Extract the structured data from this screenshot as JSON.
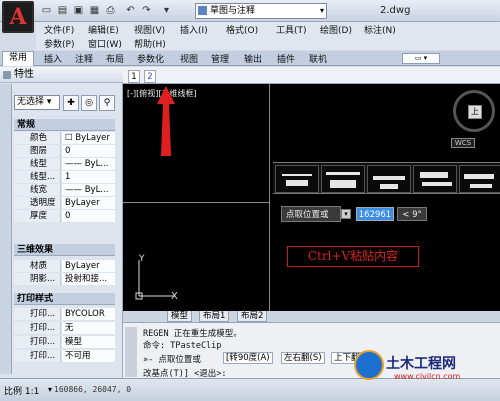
{
  "app": {
    "logo_letter": "A",
    "workspace": "草图与注释",
    "document_title": "2.dwg"
  },
  "menu_row1": [
    "文件(F)",
    "编辑(E)",
    "视图(V)",
    "插入(I)",
    "格式(O)",
    "工具(T)",
    "绘图(D)",
    "标注(N)"
  ],
  "menu_row2": [
    "参数(P)",
    "窗口(W)",
    "帮助(H)"
  ],
  "ribbon_tabs": [
    "常用",
    "插入",
    "注释",
    "布局",
    "参数化",
    "视图",
    "管理",
    "输出",
    "插件",
    "联机"
  ],
  "properties": {
    "title": "特性",
    "selection": "无选择",
    "sections": [
      {
        "name": "常规",
        "rows": [
          [
            "颜色",
            "☐ ByLayer"
          ],
          [
            "图层",
            "0"
          ],
          [
            "线型",
            "—— ByL..."
          ],
          [
            "线型...",
            "1"
          ],
          [
            "线宽",
            "—— ByL..."
          ],
          [
            "透明度",
            "ByLayer"
          ],
          [
            "厚度",
            "0"
          ]
        ]
      },
      {
        "name": "三维效果",
        "rows": [
          [
            "材质",
            "ByLayer"
          ],
          [
            "阴影...",
            "投射和接..."
          ]
        ]
      },
      {
        "name": "打印样式",
        "rows": [
          [
            "打印...",
            "BYCOLOR"
          ],
          [
            "打印...",
            "无"
          ],
          [
            "打印...",
            "模型"
          ],
          [
            "打印...",
            "不可用"
          ]
        ]
      }
    ]
  },
  "doc_tabs": [
    "1",
    "2"
  ],
  "viewport_label": "[-][俯视][二维线框]",
  "viewcube": {
    "face": "上",
    "wcs": "WCS"
  },
  "snap": {
    "label": "点取位置或",
    "value": "162961",
    "angle": "< 9°"
  },
  "annotation": "Ctrl+V粘贴内容",
  "ucs": {
    "y": "Y",
    "x": "X"
  },
  "space_tabs": [
    "模型",
    "布局1",
    "布局2"
  ],
  "command": {
    "line1": "REGEN 正在重生成模型。",
    "line2": "命令: TPasteClip",
    "line3_prefix": "»- 点取位置或",
    "options": [
      "[转90度(A)",
      "左右翻(S)",
      "上下翻"
    ],
    "line4": "改基点(T)] <退出>:"
  },
  "status": {
    "scale": "比例 1:1",
    "coords": "160866, 26047, 0"
  },
  "watermark": {
    "title": "土木工程网",
    "url": "www.civilcn.com"
  },
  "colors": {
    "canvas": "#000000",
    "highlight": "#3a8ee6",
    "annotation": "#e02020"
  }
}
